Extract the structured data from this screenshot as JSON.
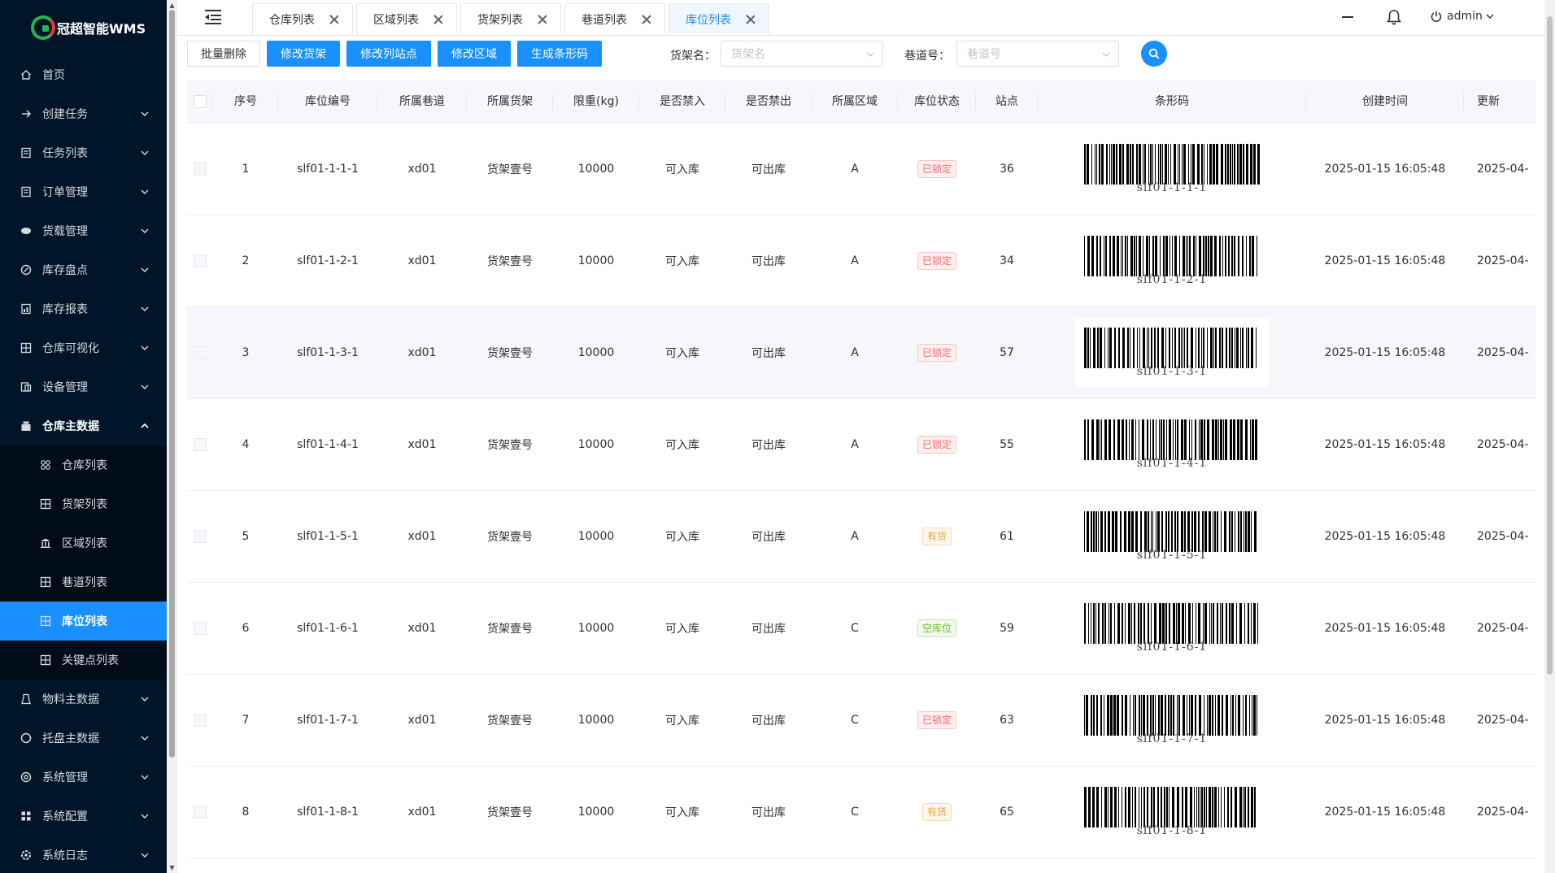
{
  "app": {
    "title": "冠超智能WMS"
  },
  "sidebar": {
    "items": [
      {
        "label": "首页",
        "icon": "home-icon"
      },
      {
        "label": "创建任务",
        "icon": "arrow-right-icon"
      },
      {
        "label": "任务列表",
        "icon": "list-icon"
      },
      {
        "label": "订单管理",
        "icon": "list-icon"
      },
      {
        "label": "货载管理",
        "icon": "database-icon"
      },
      {
        "label": "库存盘点",
        "icon": "check-circle-icon"
      },
      {
        "label": "库存报表",
        "icon": "report-icon"
      },
      {
        "label": "仓库可视化",
        "icon": "grid-icon"
      },
      {
        "label": "设备管理",
        "icon": "device-icon"
      },
      {
        "label": "仓库主数据",
        "icon": "warehouse-icon"
      }
    ],
    "subitems": [
      {
        "label": "仓库列表",
        "icon": "cluster-icon"
      },
      {
        "label": "货架列表",
        "icon": "grid-icon"
      },
      {
        "label": "区域列表",
        "icon": "bank-icon"
      },
      {
        "label": "巷道列表",
        "icon": "grid-icon"
      },
      {
        "label": "库位列表",
        "icon": "grid-icon"
      },
      {
        "label": "关键点列表",
        "icon": "grid-icon"
      }
    ],
    "items_after": [
      {
        "label": "物料主数据",
        "icon": "material-icon"
      },
      {
        "label": "托盘主数据",
        "icon": "circle-icon"
      },
      {
        "label": "系统管理",
        "icon": "settings-icon"
      },
      {
        "label": "系统配置",
        "icon": "apps-icon"
      },
      {
        "label": "系统日志",
        "icon": "log-icon"
      }
    ]
  },
  "tabs": [
    {
      "label": "仓库列表"
    },
    {
      "label": "区域列表"
    },
    {
      "label": "货架列表"
    },
    {
      "label": "巷道列表"
    },
    {
      "label": "库位列表"
    }
  ],
  "header": {
    "user": "admin"
  },
  "toolbar": {
    "batch_delete": "批量删除",
    "edit_shelf": "修改货架",
    "edit_site": "修改列站点",
    "edit_area": "修改区域",
    "gen_barcode": "生成条形码"
  },
  "filters": {
    "shelf_label": "货架名：",
    "shelf_placeholder": "货架名",
    "lane_label": "巷道号：",
    "lane_placeholder": "巷道号"
  },
  "table": {
    "headers": [
      "序号",
      "库位编号",
      "所属巷道",
      "所属货架",
      "限重(kg)",
      "是否禁入",
      "是否禁出",
      "所属区域",
      "库位状态",
      "站点",
      "条形码",
      "创建时间",
      "更新"
    ],
    "rows": [
      {
        "no": "1",
        "code": "slf01-1-1-1",
        "lane": "xd01",
        "shelf": "货架壹号",
        "limit": "10000",
        "in": "可入库",
        "out": "可出库",
        "area": "A",
        "status": "已锁定",
        "status_type": "locked",
        "site": "36",
        "barcode": "slf01-1-1-1",
        "created": "2025-01-15 16:05:48",
        "updated": "2025-04-"
      },
      {
        "no": "2",
        "code": "slf01-1-2-1",
        "lane": "xd01",
        "shelf": "货架壹号",
        "limit": "10000",
        "in": "可入库",
        "out": "可出库",
        "area": "A",
        "status": "已锁定",
        "status_type": "locked",
        "site": "34",
        "barcode": "slf01-1-2-1",
        "created": "2025-01-15 16:05:48",
        "updated": "2025-04-"
      },
      {
        "no": "3",
        "code": "slf01-1-3-1",
        "lane": "xd01",
        "shelf": "货架壹号",
        "limit": "10000",
        "in": "可入库",
        "out": "可出库",
        "area": "A",
        "status": "已锁定",
        "status_type": "locked",
        "site": "57",
        "barcode": "slf01-1-3-1",
        "created": "2025-01-15 16:05:48",
        "updated": "2025-04-"
      },
      {
        "no": "4",
        "code": "slf01-1-4-1",
        "lane": "xd01",
        "shelf": "货架壹号",
        "limit": "10000",
        "in": "可入库",
        "out": "可出库",
        "area": "A",
        "status": "已锁定",
        "status_type": "locked",
        "site": "55",
        "barcode": "slf01-1-4-1",
        "created": "2025-01-15 16:05:48",
        "updated": "2025-04-"
      },
      {
        "no": "5",
        "code": "slf01-1-5-1",
        "lane": "xd01",
        "shelf": "货架壹号",
        "limit": "10000",
        "in": "可入库",
        "out": "可出库",
        "area": "A",
        "status": "有货",
        "status_type": "stock",
        "site": "61",
        "barcode": "slf01-1-5-1",
        "created": "2025-01-15 16:05:48",
        "updated": "2025-04-"
      },
      {
        "no": "6",
        "code": "slf01-1-6-1",
        "lane": "xd01",
        "shelf": "货架壹号",
        "limit": "10000",
        "in": "可入库",
        "out": "可出库",
        "area": "C",
        "status": "空库位",
        "status_type": "empty",
        "site": "59",
        "barcode": "slf01-1-6-1",
        "created": "2025-01-15 16:05:48",
        "updated": "2025-04-"
      },
      {
        "no": "7",
        "code": "slf01-1-7-1",
        "lane": "xd01",
        "shelf": "货架壹号",
        "limit": "10000",
        "in": "可入库",
        "out": "可出库",
        "area": "C",
        "status": "已锁定",
        "status_type": "locked",
        "site": "63",
        "barcode": "slf01-1-7-1",
        "created": "2025-01-15 16:05:48",
        "updated": "2025-04-"
      },
      {
        "no": "8",
        "code": "slf01-1-8-1",
        "lane": "xd01",
        "shelf": "货架壹号",
        "limit": "10000",
        "in": "可入库",
        "out": "可出库",
        "area": "C",
        "status": "有货",
        "status_type": "stock",
        "site": "65",
        "barcode": "slf01-1-8-1",
        "created": "2025-01-15 16:05:48",
        "updated": "2025-04-"
      }
    ]
  },
  "colors": {
    "sidebar_bg": "#001529",
    "primary": "#1890ff",
    "locked": "#f56c6c",
    "stock": "#e6a23c",
    "empty": "#67c23a"
  }
}
